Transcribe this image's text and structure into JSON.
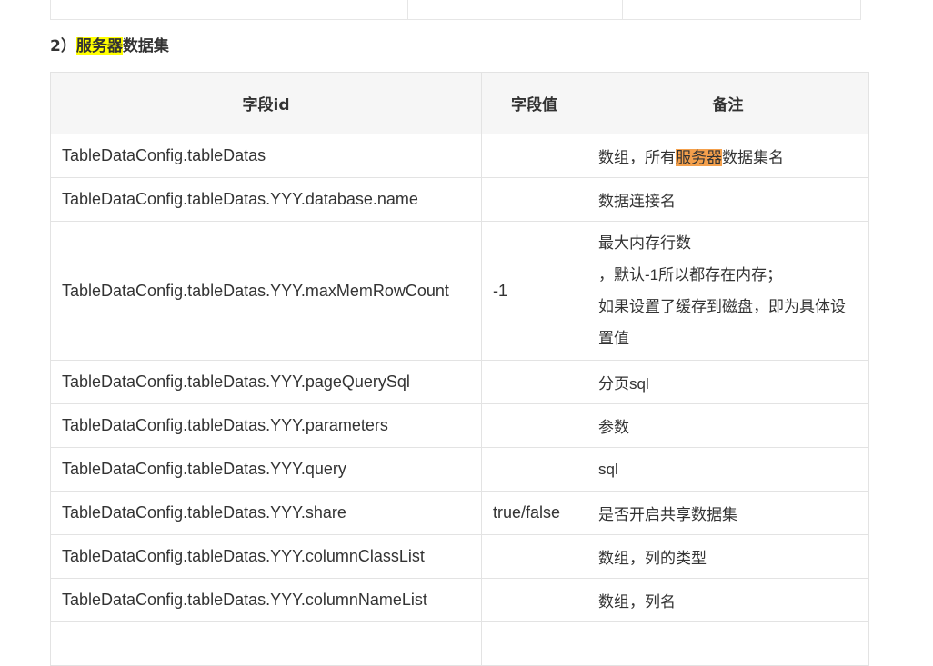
{
  "section": {
    "prefix": "2）",
    "highlight": "服务器",
    "suffix": "数据集"
  },
  "table": {
    "headers": [
      "字段id",
      "字段值",
      "备注"
    ],
    "rows": [
      {
        "field": "TableDataConfig.tableDatas",
        "value": "",
        "note_prefix": "数组，所有",
        "note_highlight": "服务器",
        "note_suffix": "数据集名"
      },
      {
        "field": "TableDataConfig.tableDatas.YYY.database.name",
        "value": "",
        "note": "数据连接名"
      },
      {
        "field": "TableDataConfig.tableDatas.YYY.maxMemRowCount",
        "value": "-1",
        "note_lines": [
          "最大内存行数",
          "，默认-1所以都存在内存；",
          "如果设置了缓存到磁盘，即为具体设",
          "置值"
        ]
      },
      {
        "field": "TableDataConfig.tableDatas.YYY.pageQuerySql",
        "value": "",
        "note": "分页sql"
      },
      {
        "field": "TableDataConfig.tableDatas.YYY.parameters",
        "value": "",
        "note": "参数"
      },
      {
        "field": "TableDataConfig.tableDatas.YYY.query",
        "value": "",
        "note": "sql"
      },
      {
        "field": "TableDataConfig.tableDatas.YYY.share",
        "value": "true/false",
        "note": "是否开启共享数据集"
      },
      {
        "field": "TableDataConfig.tableDatas.YYY.columnClassList",
        "value": "",
        "note": "数组，列的类型"
      },
      {
        "field": "TableDataConfig.tableDatas.YYY.columnNameList",
        "value": "",
        "note": "数组，列名"
      }
    ]
  }
}
